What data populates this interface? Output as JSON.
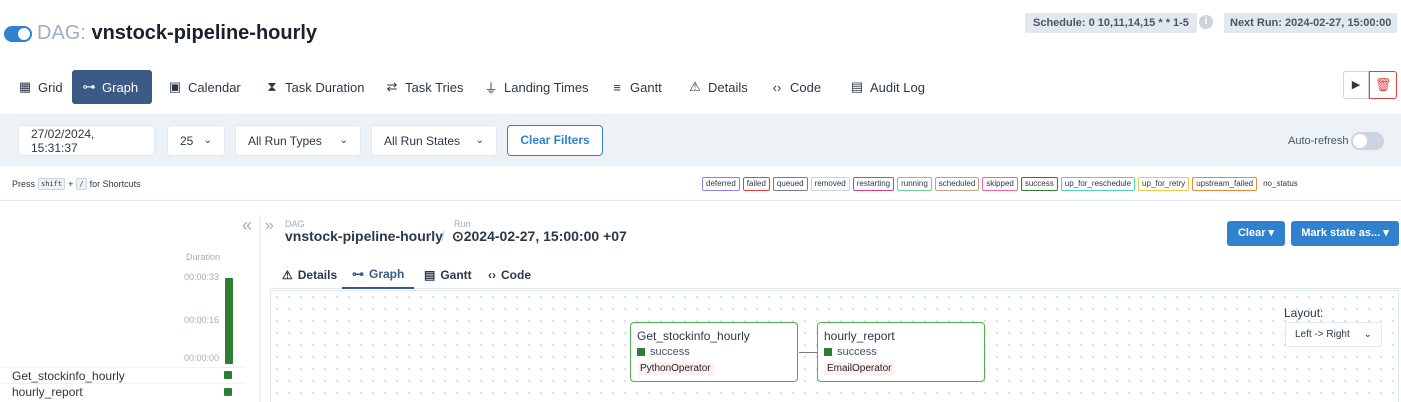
{
  "header": {
    "dag_prefix": "DAG:",
    "dag_id": "vnstock-pipeline-hourly",
    "schedule": "Schedule: 0 10,11,14,15 * * 1-5",
    "info_icon_glyph": "i",
    "next_run": "Next Run: 2024-02-27, 15:00:00"
  },
  "nav": {
    "grid": "Grid",
    "graph": "Graph",
    "calendar": "Calendar",
    "task_duration": "Task Duration",
    "task_tries": "Task Tries",
    "landing_times": "Landing Times",
    "gantt": "Gantt",
    "details": "Details",
    "code": "Code",
    "audit_log": "Audit Log"
  },
  "filters": {
    "date": "27/02/2024, 15:31:37",
    "num_runs": "25",
    "run_types": "All Run Types",
    "run_states": "All Run States",
    "clear_filters": "Clear Filters",
    "auto_refresh": "Auto-refresh"
  },
  "shortcuts": {
    "press": "Press",
    "key1": "shift",
    "plus": "+",
    "key2": "/",
    "for": "for Shortcuts"
  },
  "legend": [
    {
      "label": "deferred",
      "color": "#9f7aea"
    },
    {
      "label": "failed",
      "color": "#e53e3e"
    },
    {
      "label": "queued",
      "color": "#718096"
    },
    {
      "label": "removed",
      "color": "#cbd5e0"
    },
    {
      "label": "restarting",
      "color": "#d53f8c"
    },
    {
      "label": "running",
      "color": "#68d391"
    },
    {
      "label": "scheduled",
      "color": "#c4a484"
    },
    {
      "label": "skipped",
      "color": "#ed64a6"
    },
    {
      "label": "success",
      "color": "#2f7d32"
    },
    {
      "label": "up_for_reschedule",
      "color": "#4fd1c5"
    },
    {
      "label": "up_for_retry",
      "color": "#ecc94b"
    },
    {
      "label": "upstream_failed",
      "color": "#ed8936"
    },
    {
      "label": "no_status",
      "color": ""
    }
  ],
  "grid_panel": {
    "duration_label": "Duration",
    "ticks": [
      "00:00:33",
      "00:00:16",
      "00:00:00"
    ],
    "tasks": [
      "Get_stockinfo_hourly",
      "hourly_report"
    ],
    "collapse_glyph": "«"
  },
  "detail": {
    "expand_glyph": "»",
    "dag_small": "DAG",
    "dag_id": "vnstock-pipeline-hourly",
    "slash": "/",
    "run_small": "Run",
    "run_id": "⊙2024-02-27, 15:00:00 +07",
    "clear_btn": "Clear ▾",
    "mark_btn": "Mark state as... ▾",
    "tabs": {
      "details": "Details",
      "graph": "Graph",
      "gantt": "Gantt",
      "code": "Code"
    }
  },
  "graph": {
    "nodes": [
      {
        "name": "Get_stockinfo_hourly",
        "state": "success",
        "operator": "PythonOperator"
      },
      {
        "name": "hourly_report",
        "state": "success",
        "operator": "EmailOperator"
      }
    ],
    "layout_label": "Layout:",
    "layout_value": "Left -> Right"
  },
  "colors": {
    "accent": "#3182ce",
    "nav_active": "#3b5a86",
    "success": "#2f7d32",
    "delete": "#e53e3e"
  }
}
